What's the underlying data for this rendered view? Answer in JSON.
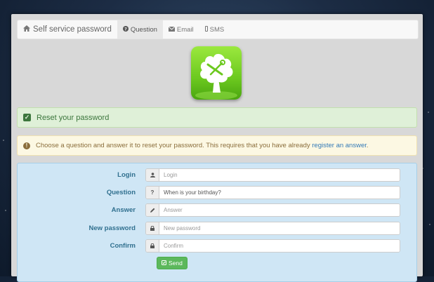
{
  "navbar": {
    "brand_icon": "home-icon",
    "brand_label": "Self service password",
    "tabs": [
      {
        "icon": "question-circle-icon",
        "label": "Question",
        "active": true
      },
      {
        "icon": "envelope-icon",
        "label": "Email",
        "active": false
      },
      {
        "icon": "mobile-icon",
        "label": "SMS",
        "active": false
      }
    ]
  },
  "logo": {
    "icon": "tree-tools-icon"
  },
  "success_alert": {
    "text": "Reset your password",
    "icon": "check-square-icon"
  },
  "info_alert": {
    "icon": "info-circle-icon",
    "text": "Choose a question and answer it to reset your password. This requires that you have already",
    "link": "register an answer",
    "suffix": "."
  },
  "form": {
    "login": {
      "label": "Login",
      "placeholder": "Login",
      "icon": "user-icon"
    },
    "question": {
      "label": "Question",
      "value": "When is your birthday?",
      "icon": "question-icon"
    },
    "answer": {
      "label": "Answer",
      "placeholder": "Answer",
      "icon": "pencil-icon"
    },
    "new_password": {
      "label": "New password",
      "placeholder": "New password",
      "icon": "lock-icon"
    },
    "confirm": {
      "label": "Confirm",
      "placeholder": "Confirm",
      "icon": "lock-icon"
    },
    "send_label": "Send"
  },
  "colors": {
    "success": "#dff0d8",
    "warning": "#fcf8e3",
    "info": "#cfe6f5",
    "button": "#5cb85c",
    "logo": "#6cc91f"
  }
}
